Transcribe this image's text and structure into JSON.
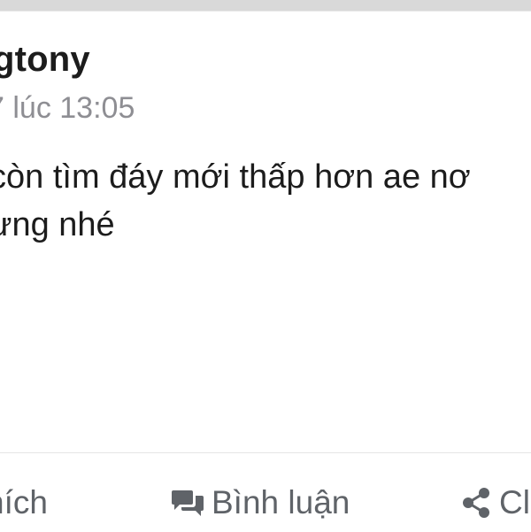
{
  "post": {
    "author": "gtony",
    "timestamp": "7 lúc 13:05",
    "lines": [
      "còn tìm đáy mới thấp hơn ae nơ",
      "ưng nhé"
    ]
  },
  "actions": {
    "like_label": "hích",
    "comment_label": "Bình luận",
    "share_label": "Cl"
  },
  "icons": {
    "comment": "comment-bubbles-icon",
    "share": "share-icon"
  },
  "colors": {
    "background": "#d9d9d9",
    "card": "#ffffff",
    "text": "#1c1c1c",
    "muted": "#8e8e93",
    "action": "#5f6368"
  }
}
